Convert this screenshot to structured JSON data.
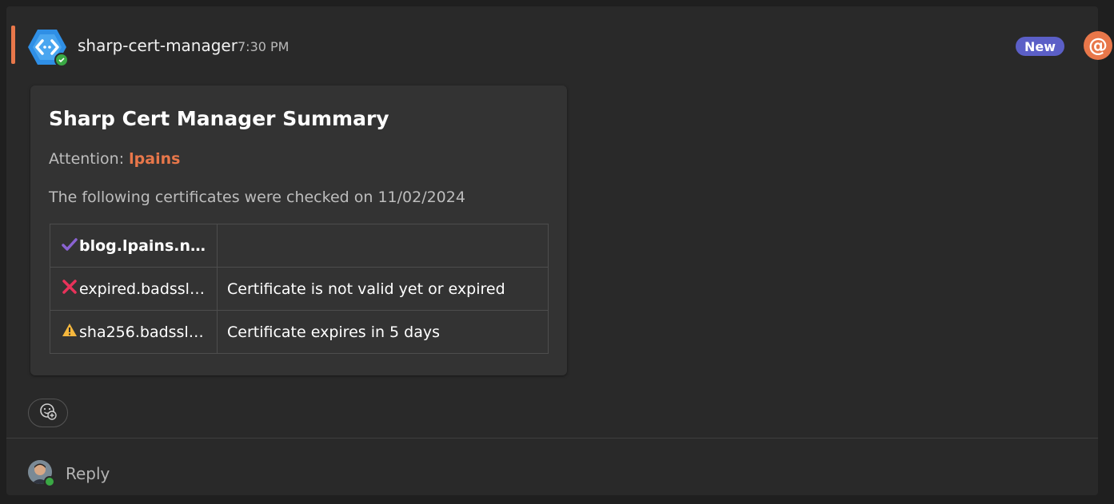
{
  "message": {
    "sender": "sharp-cert-manager",
    "time": "7:30 PM",
    "badge": "New",
    "mention_icon": "at-icon"
  },
  "card": {
    "title": "Sharp Cert Manager Summary",
    "attention_label": "Attention:",
    "attention_user": "lpains",
    "checked_text": "The following certificates were checked on 11/02/2024",
    "rows": [
      {
        "icon": "check-icon",
        "name": "blog.lpains.net",
        "status": ""
      },
      {
        "icon": "cross-icon",
        "name": "expired.badssl....",
        "status": "Certificate is not valid yet or expired"
      },
      {
        "icon": "warning-icon",
        "name": "sha256.badssl....",
        "status": "Certificate expires in 5 days"
      }
    ]
  },
  "footer": {
    "reply_label": "Reply"
  },
  "colors": {
    "accent": "#e8774a",
    "badge": "#5b5fc7",
    "online": "#3aa844"
  }
}
